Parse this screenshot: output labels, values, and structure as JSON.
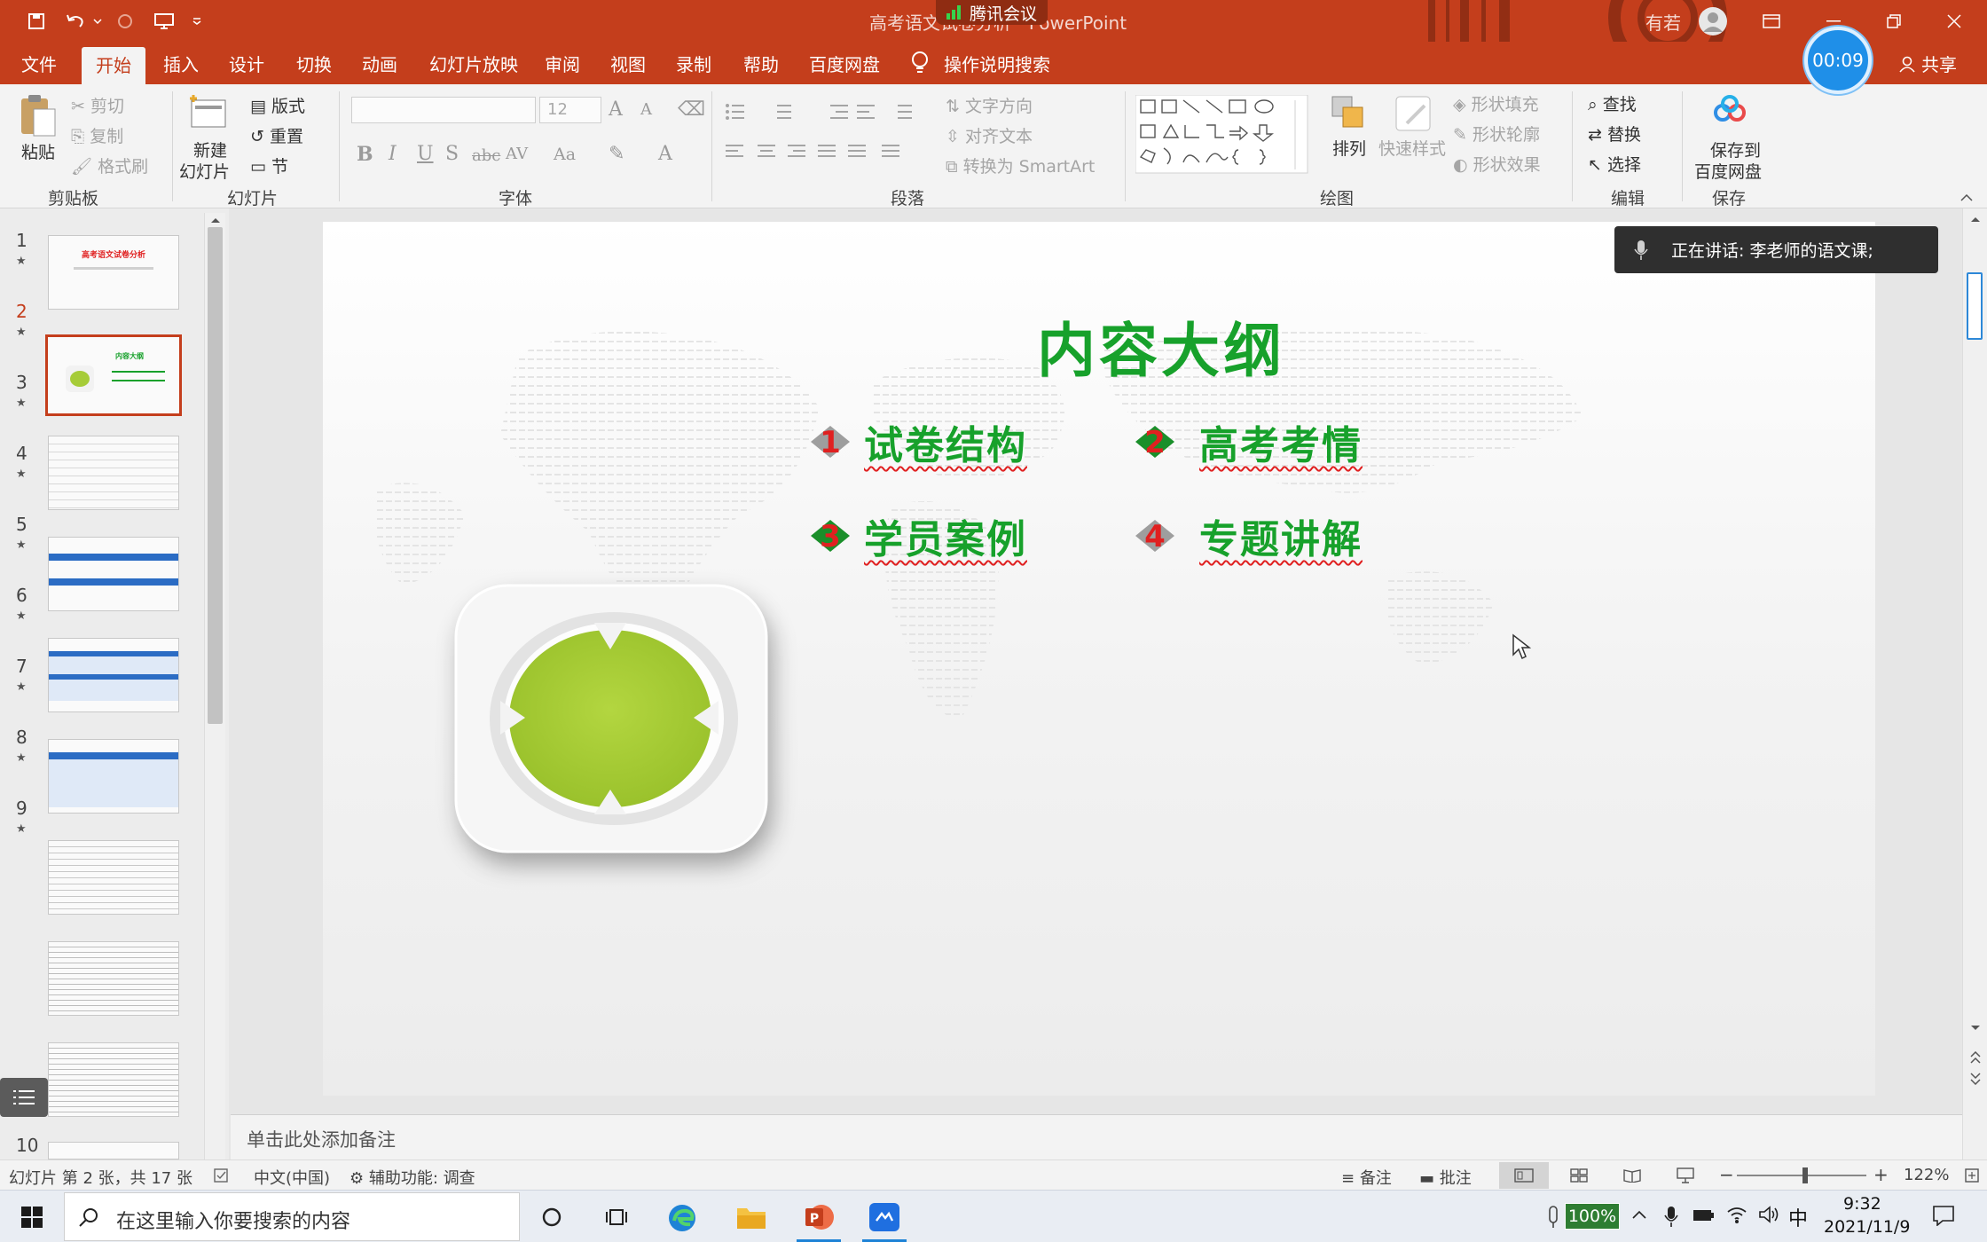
{
  "window": {
    "title": "高考语文试卷分析 - PowerPoint",
    "meeting": "腾讯会议",
    "user": "有若"
  },
  "tabs": [
    "文件",
    "开始",
    "插入",
    "设计",
    "切换",
    "动画",
    "幻灯片放映",
    "审阅",
    "视图",
    "录制",
    "帮助",
    "百度网盘"
  ],
  "active_tab": "开始",
  "tell_me": "操作说明搜索",
  "timer": "00:09",
  "share": "共享",
  "ribbon": {
    "clipboard": {
      "label": "剪贴板",
      "paste": "粘贴",
      "cut": "剪切",
      "copy": "复制",
      "format_painter": "格式刷"
    },
    "slides": {
      "label": "幻灯片",
      "new_slide_1": "新建",
      "new_slide_2": "幻灯片",
      "layout": "版式",
      "reset": "重置",
      "section": "节"
    },
    "font": {
      "label": "字体",
      "font_size": "12"
    },
    "paragraph": {
      "label": "段落",
      "text_direction": "文字方向",
      "align_text": "对齐文本",
      "smartart": "转换为 SmartArt"
    },
    "drawing": {
      "label": "绘图",
      "arrange": "排列",
      "quick_styles": "快速样式",
      "shape_fill": "形状填充",
      "shape_outline": "形状轮廓",
      "shape_effects": "形状效果"
    },
    "editing": {
      "label": "编辑",
      "find": "查找",
      "replace": "替换",
      "select": "选择"
    },
    "save": {
      "label": "保存",
      "save_to_1": "保存到",
      "save_to_2": "百度网盘"
    }
  },
  "slide_numbers": [
    "1",
    "2",
    "3",
    "4",
    "5",
    "6",
    "7",
    "8",
    "9",
    "10"
  ],
  "thumbnails": {
    "slide1_title": "高考语文试卷分析",
    "slide2_title": "内容大纲"
  },
  "slide": {
    "title": "内容大纲",
    "items": [
      {
        "num": "1",
        "text": "试卷结构",
        "num_color": "#e02020",
        "diamond": "#9e9e9e"
      },
      {
        "num": "2",
        "text": "高考考情",
        "num_color": "#e02020",
        "diamond": "#1a8f2a"
      },
      {
        "num": "3",
        "text": "学员案例",
        "num_color": "#e02020",
        "diamond": "#1a8f2a"
      },
      {
        "num": "4",
        "text": "专题讲解",
        "num_color": "#e02020",
        "diamond": "#9e9e9e"
      }
    ],
    "accent": "#17a12b",
    "circle_color": "#a6cc38"
  },
  "speaking": "正在讲话: 李老师的语文课;",
  "notes_placeholder": "单击此处添加备注",
  "status": {
    "slide_info": "幻灯片 第 2 张，共 17 张",
    "language": "中文(中国)",
    "accessibility": "辅助功能: 调查",
    "notes": "备注",
    "comments": "批注",
    "zoom": "122%"
  },
  "taskbar": {
    "search_placeholder": "在这里输入你要搜索的内容",
    "battery": "100%",
    "ime": "中",
    "time": "9:32",
    "date": "2021/11/9"
  }
}
